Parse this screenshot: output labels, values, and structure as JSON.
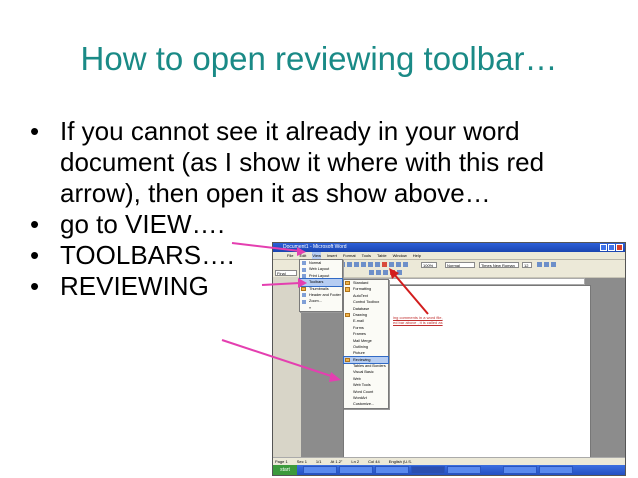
{
  "title": "How to open reviewing toolbar…",
  "bullets": [
    "If you cannot see it already in your word document (as I show it where with this red arrow), then open it as show above…",
    "go to VIEW….",
    "TOOLBARS….",
    "REVIEWING"
  ],
  "colors": {
    "title": "#1a8a86",
    "arrow_pink": "#e43fb0",
    "arrow_red": "#d21d1d"
  },
  "screenshot": {
    "window_title": "Document1 - Microsoft Word",
    "menubar": [
      "File",
      "Edit",
      "View",
      "Insert",
      "Format",
      "Tools",
      "Table",
      "Window",
      "Help"
    ],
    "style_box": "Normal",
    "font_box": "Times New Roman",
    "size_box": "12",
    "zoom_box": "100%",
    "left_pane_label": "Final Showing",
    "view_menu": [
      {
        "label": "Normal",
        "state": "icon"
      },
      {
        "label": "Web Layout",
        "state": "icon"
      },
      {
        "label": "Print Layout",
        "state": "icon"
      },
      {
        "label": "Toolbars",
        "state": "highlight"
      },
      {
        "label": "Thumbnails",
        "state": "check"
      },
      {
        "label": "Header and Footer",
        "state": "icon"
      },
      {
        "label": "Zoom...",
        "state": "icon"
      },
      {
        "label": "»",
        "state": "none"
      }
    ],
    "toolbars_menu": [
      {
        "label": "Standard",
        "state": "check"
      },
      {
        "label": "Formatting",
        "state": "check"
      },
      {
        "label": "AutoText",
        "state": "none"
      },
      {
        "label": "Control Toolbox",
        "state": "none"
      },
      {
        "label": "Database",
        "state": "none"
      },
      {
        "label": "Drawing",
        "state": "check"
      },
      {
        "label": "E-mail",
        "state": "none"
      },
      {
        "label": "Forms",
        "state": "none"
      },
      {
        "label": "Frames",
        "state": "none"
      },
      {
        "label": "Mail Merge",
        "state": "none"
      },
      {
        "label": "Outlining",
        "state": "none"
      },
      {
        "label": "Picture",
        "state": "none"
      },
      {
        "label": "Reviewing",
        "state": "highlight"
      },
      {
        "label": "Tables and Borders",
        "state": "none"
      },
      {
        "label": "Visual Basic",
        "state": "none"
      },
      {
        "label": "Web",
        "state": "none"
      },
      {
        "label": "Web Tools",
        "state": "none"
      },
      {
        "label": "Word Count",
        "state": "none"
      },
      {
        "label": "WordArt",
        "state": "none"
      },
      {
        "label": "Customize...",
        "state": "none"
      }
    ],
    "doc_text": [
      "ing comments in a word file,",
      "ed bar above , it is called as"
    ],
    "status": [
      "Page 1",
      "Sec 1",
      "1/1",
      "At 1.2\"",
      "Ln 2",
      "Col 44",
      "English (U.S."
    ],
    "start_label": "start"
  }
}
